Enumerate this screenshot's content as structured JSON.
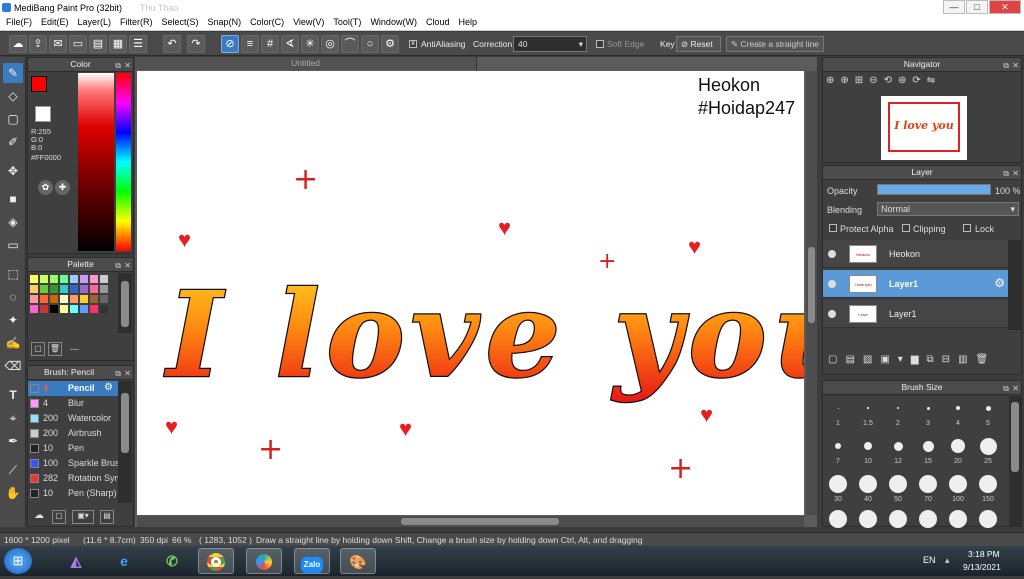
{
  "window": {
    "title": "MediBang Paint Pro (32bit)",
    "ghost_title": "Thu Thao",
    "btn_min": "—",
    "btn_max": "□",
    "btn_close": "✕"
  },
  "menu": [
    "File(F)",
    "Edit(E)",
    "Layer(L)",
    "Filter(R)",
    "Select(S)",
    "Snap(N)",
    "Color(C)",
    "View(V)",
    "Tool(T)",
    "Window(W)",
    "Cloud",
    "Help"
  ],
  "toolbar": {
    "antialiasing": "AntiAliasing",
    "correction_label": "Correction",
    "correction_value": "40",
    "soft_edge": "Soft Edge",
    "key_label": "Key",
    "reset": "Reset",
    "straight_line": "Create a straight line"
  },
  "color_panel": {
    "title": "Color",
    "primary": "#ff0000",
    "r": "R:255",
    "g": "G:0",
    "b": "B:0",
    "hex": "#FF0000"
  },
  "palette_panel": {
    "title": "Palette",
    "swatches": [
      "#ffff66",
      "#ccff66",
      "#99ff66",
      "#66ff99",
      "#99ccff",
      "#cc99ff",
      "#ff99cc",
      "#cccccc",
      "#ffcc66",
      "#66cc33",
      "#339933",
      "#33cccc",
      "#3366cc",
      "#9966cc",
      "#ff6699",
      "#999999",
      "#ff9999",
      "#ff6633",
      "#cc6600",
      "#ffffcc",
      "#ff9966",
      "#ffcc33",
      "#996633",
      "#666666",
      "#ff66cc",
      "#cc3333",
      "#000000",
      "#ffff99",
      "#66ffff",
      "#6699ff",
      "#ff3366",
      "#333333"
    ],
    "dashes": "---"
  },
  "brush_panel": {
    "title": "Brush: Pencil",
    "items": [
      {
        "size": "4",
        "name": "Pencil",
        "color": "#3b7bbf"
      },
      {
        "size": "4",
        "name": "Blur",
        "color": "#ff99ff"
      },
      {
        "size": "200",
        "name": "Watercolor",
        "color": "#99ddff"
      },
      {
        "size": "200",
        "name": "Airbrush",
        "color": "#cccccc"
      },
      {
        "size": "10",
        "name": "Pen",
        "color": "#222222"
      },
      {
        "size": "100",
        "name": "Sparkle Brush",
        "color": "#3355ff"
      },
      {
        "size": "282",
        "name": "Rotation Sym",
        "color": "#ee3333"
      },
      {
        "size": "10",
        "name": "Pen (Sharp)",
        "color": "#222222"
      }
    ]
  },
  "doc": {
    "tab": "Untitled",
    "watermark1": "Heokon",
    "watermark2": "#Hoidap247",
    "line1": "I love you"
  },
  "navigator": {
    "title": "Navigator",
    "thumb_text": "I love you"
  },
  "layer_panel": {
    "title": "Layer",
    "opacity_label": "Opacity",
    "opacity_value": "100 %",
    "opacity_fraction": 1.0,
    "blending_label": "Blending",
    "blending_value": "Normal",
    "protect_alpha": "Protect Alpha",
    "clipping": "Clipping",
    "lock": "Lock",
    "layers": [
      {
        "name": "Heokon",
        "thumb": "Heokon",
        "selected": false
      },
      {
        "name": "Layer1",
        "thumb": "I love you",
        "selected": true
      },
      {
        "name": "Layer1",
        "thumb": "I love",
        "selected": false
      }
    ]
  },
  "brush_size": {
    "title": "Brush Size",
    "sizes": [
      "1",
      "1.5",
      "2",
      "3",
      "4",
      "5",
      "7",
      "10",
      "12",
      "15",
      "20",
      "25",
      "30",
      "40",
      "50",
      "70",
      "100",
      "150"
    ]
  },
  "status": {
    "size": "1600 * 1200 pixel",
    "cm": "(11.6 * 8.7cm)",
    "dpi": "350 dpi",
    "zoom": "66 %",
    "coords": "( 1283, 1052 )",
    "hint": "Draw a straight line by holding down Shift, Change a brush size by holding down Ctrl, Alt, and dragging"
  },
  "taskbar": {
    "lang": "EN",
    "time": "3:18 PM",
    "date": "9/13/2021",
    "zalo": "Zalo"
  }
}
